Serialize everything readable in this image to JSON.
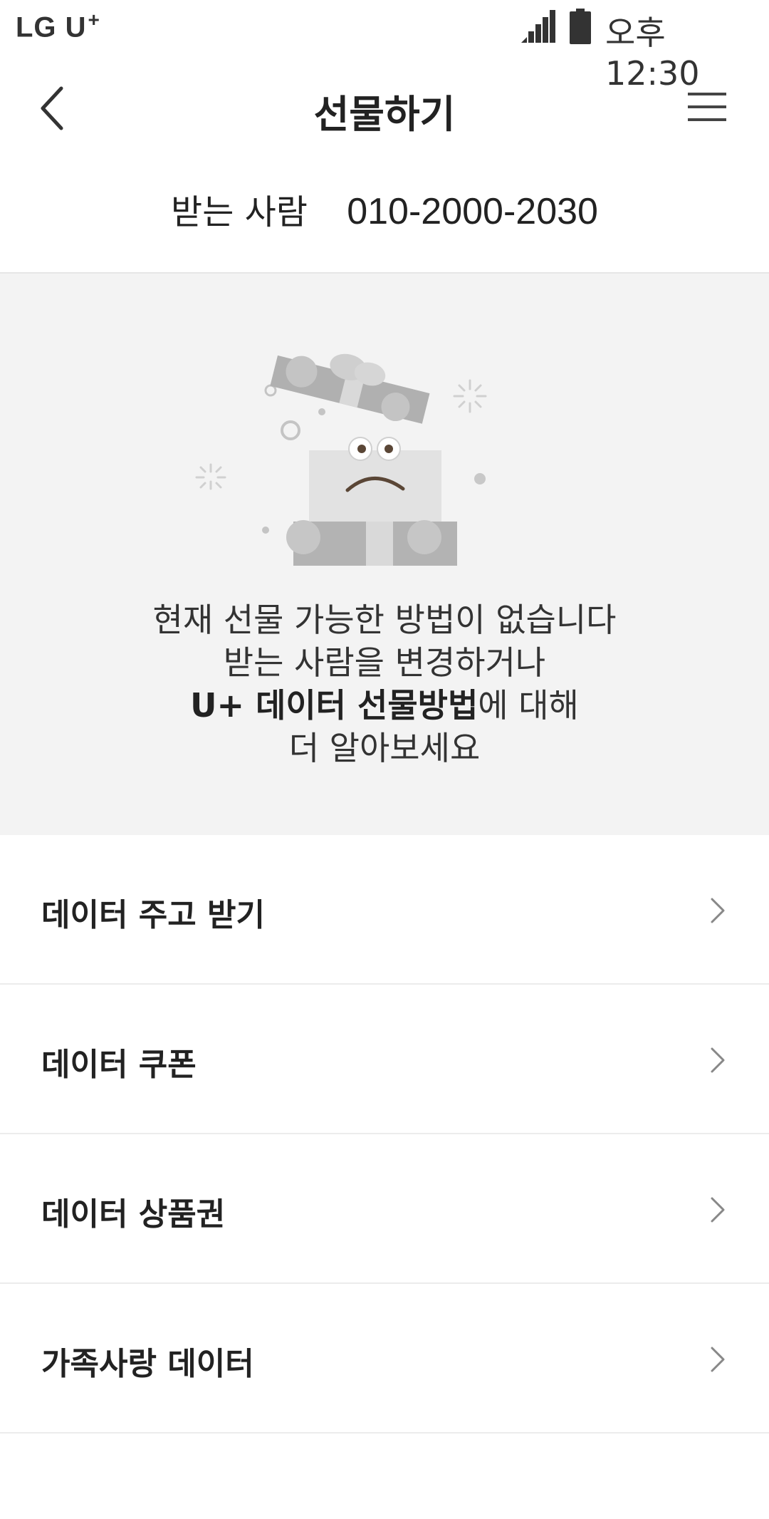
{
  "status_bar": {
    "carrier": "LG U",
    "carrier_plus": "+",
    "time": "오후 12:30",
    "signal_icon": "signal-icon",
    "battery_icon": "battery-icon"
  },
  "app_bar": {
    "back_icon": "back-arrow-icon",
    "title": "선물하기",
    "menu_icon": "hamburger-menu-icon"
  },
  "recipient": {
    "label": "받는 사람",
    "phone": "010-2000-2030"
  },
  "empty_state": {
    "illustration": "sad-gift-box-illustration",
    "line1": "현재 선물 가능한 방법이 없습니다",
    "line2": "받는 사람을 변경하거나",
    "line3_bold": "U+ 데이터 선물방법",
    "line3_rest": "에 대해",
    "line4": "더 알아보세요"
  },
  "menu": {
    "items": [
      {
        "label": "데이터 주고 받기"
      },
      {
        "label": "데이터 쿠폰"
      },
      {
        "label": "데이터 상품권"
      },
      {
        "label": "가족사랑 데이터"
      }
    ],
    "chevron_icon": "chevron-right-icon"
  },
  "colors": {
    "panel_background": "#f3f3f3",
    "text_primary": "#222222",
    "divider": "#ececec",
    "illustration_gray": "#b3b3b3"
  }
}
